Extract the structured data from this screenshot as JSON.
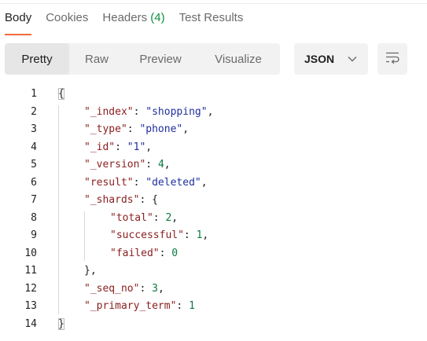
{
  "tabs": [
    {
      "label": "Body",
      "count": ""
    },
    {
      "label": "Cookies",
      "count": ""
    },
    {
      "label": "Headers",
      "count": "(4)"
    },
    {
      "label": "Test Results",
      "count": ""
    }
  ],
  "view_modes": [
    "Pretty",
    "Raw",
    "Preview",
    "Visualize"
  ],
  "format": {
    "selected": "JSON"
  },
  "icons": {
    "dropdown": "chevron-down-icon",
    "wrap": "text-wrap-icon"
  },
  "colors": {
    "accent": "#f26b3a",
    "key": "#8a1e1e",
    "string": "#1f2f9e",
    "number": "#0a7a3f",
    "count": "#0c8f3d"
  },
  "lines": [
    {
      "no": "1",
      "indent": 0,
      "tokens": [
        {
          "t": "{",
          "c": "p"
        }
      ]
    },
    {
      "no": "2",
      "indent": 1,
      "tokens": [
        {
          "t": "\"_index\"",
          "c": "k"
        },
        {
          "t": ": ",
          "c": "p"
        },
        {
          "t": "\"shopping\"",
          "c": "s"
        },
        {
          "t": ",",
          "c": "p"
        }
      ]
    },
    {
      "no": "3",
      "indent": 1,
      "tokens": [
        {
          "t": "\"_type\"",
          "c": "k"
        },
        {
          "t": ": ",
          "c": "p"
        },
        {
          "t": "\"phone\"",
          "c": "s"
        },
        {
          "t": ",",
          "c": "p"
        }
      ]
    },
    {
      "no": "4",
      "indent": 1,
      "tokens": [
        {
          "t": "\"_id\"",
          "c": "k"
        },
        {
          "t": ": ",
          "c": "p"
        },
        {
          "t": "\"1\"",
          "c": "s"
        },
        {
          "t": ",",
          "c": "p"
        }
      ]
    },
    {
      "no": "5",
      "indent": 1,
      "tokens": [
        {
          "t": "\"_version\"",
          "c": "k"
        },
        {
          "t": ": ",
          "c": "p"
        },
        {
          "t": "4",
          "c": "n"
        },
        {
          "t": ",",
          "c": "p"
        }
      ]
    },
    {
      "no": "6",
      "indent": 1,
      "tokens": [
        {
          "t": "\"result\"",
          "c": "k"
        },
        {
          "t": ": ",
          "c": "p"
        },
        {
          "t": "\"deleted\"",
          "c": "s"
        },
        {
          "t": ",",
          "c": "p"
        }
      ]
    },
    {
      "no": "7",
      "indent": 1,
      "tokens": [
        {
          "t": "\"_shards\"",
          "c": "k"
        },
        {
          "t": ": {",
          "c": "p"
        }
      ]
    },
    {
      "no": "8",
      "indent": 2,
      "tokens": [
        {
          "t": "\"total\"",
          "c": "k"
        },
        {
          "t": ": ",
          "c": "p"
        },
        {
          "t": "2",
          "c": "n"
        },
        {
          "t": ",",
          "c": "p"
        }
      ]
    },
    {
      "no": "9",
      "indent": 2,
      "tokens": [
        {
          "t": "\"successful\"",
          "c": "k"
        },
        {
          "t": ": ",
          "c": "p"
        },
        {
          "t": "1",
          "c": "n"
        },
        {
          "t": ",",
          "c": "p"
        }
      ]
    },
    {
      "no": "10",
      "indent": 2,
      "tokens": [
        {
          "t": "\"failed\"",
          "c": "k"
        },
        {
          "t": ": ",
          "c": "p"
        },
        {
          "t": "0",
          "c": "n"
        }
      ]
    },
    {
      "no": "11",
      "indent": 1,
      "tokens": [
        {
          "t": "},",
          "c": "p"
        }
      ]
    },
    {
      "no": "12",
      "indent": 1,
      "tokens": [
        {
          "t": "\"_seq_no\"",
          "c": "k"
        },
        {
          "t": ": ",
          "c": "p"
        },
        {
          "t": "3",
          "c": "n"
        },
        {
          "t": ",",
          "c": "p"
        }
      ]
    },
    {
      "no": "13",
      "indent": 1,
      "tokens": [
        {
          "t": "\"_primary_term\"",
          "c": "k"
        },
        {
          "t": ": ",
          "c": "p"
        },
        {
          "t": "1",
          "c": "n"
        }
      ]
    },
    {
      "no": "14",
      "indent": 0,
      "tokens": [
        {
          "t": "}",
          "c": "p"
        }
      ]
    }
  ]
}
